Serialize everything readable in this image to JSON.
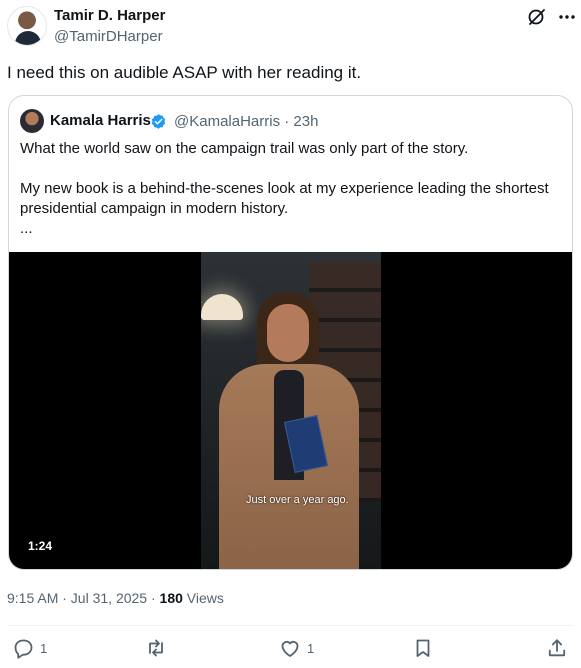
{
  "author": {
    "name": "Tamir D. Harper",
    "handle": "@TamirDHarper"
  },
  "header_icons": {
    "grok": "grok-icon",
    "more": "more-icon"
  },
  "tweet": {
    "text": "I need this on audible ASAP with her reading it."
  },
  "quote": {
    "name": "Kamala Harris",
    "handle_time": "@KamalaHarris · 23h",
    "verified_color": "#1d9bf0",
    "line1": "What the world saw on the campaign trail was only part of the story.",
    "line2": "My new book is a behind-the-scenes look at my experience leading the shortest presidential campaign in modern history.",
    "line3": "...",
    "video": {
      "caption": "Just over a year ago.",
      "duration": "1:24"
    }
  },
  "meta": {
    "time_date": "9:15 AM · Jul 31, 2025 · ",
    "views_count": "180",
    "views_label": " Views"
  },
  "actions": {
    "reply_count": "1",
    "retweet_count": "",
    "like_count": "1"
  },
  "colors": {
    "text": "#0f1419",
    "secondary": "#536471",
    "border": "#cfd9de",
    "accent": "#1d9bf0"
  }
}
